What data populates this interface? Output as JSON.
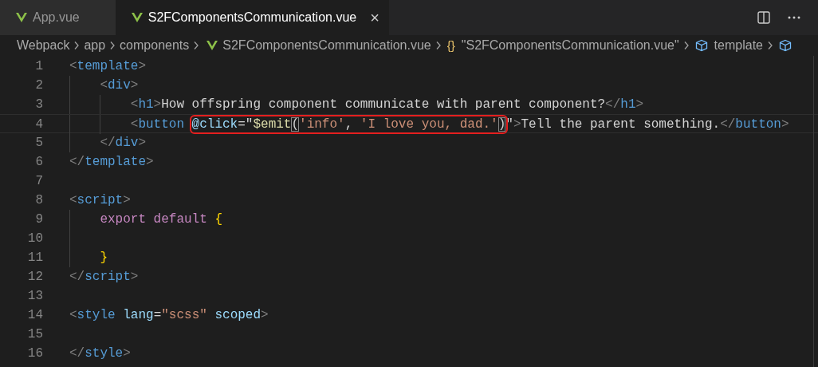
{
  "tabs": [
    {
      "label": "App.vue",
      "selected": false
    },
    {
      "label": "S2FComponentsCommunication.vue",
      "selected": true,
      "close": "×"
    }
  ],
  "breadcrumbs": [
    {
      "kind": "text",
      "label": "Webpack"
    },
    {
      "kind": "text",
      "label": "app"
    },
    {
      "kind": "text",
      "label": "components"
    },
    {
      "kind": "vue",
      "label": "S2FComponentsCommunication.vue"
    },
    {
      "kind": "object",
      "icon": "{}",
      "label": "\"S2FComponentsCommunication.vue\""
    },
    {
      "kind": "element",
      "label": "template"
    },
    {
      "kind": "element"
    }
  ],
  "lines": [
    {
      "number": "1",
      "current": false,
      "tokens": [
        {
          "kind": "punct",
          "text": "<"
        },
        {
          "kind": "tag",
          "text": "template"
        },
        {
          "kind": "punct",
          "text": ">"
        }
      ],
      "children": [
        {
          "number": "2",
          "current": false,
          "tokens": [
            {
              "kind": "punct",
              "text": "<"
            },
            {
              "kind": "tag",
              "text": "div"
            },
            {
              "kind": "punct",
              "text": ">"
            }
          ],
          "children": [
            {
              "number": "3",
              "current": false,
              "tokens": [
                {
                  "kind": "punct",
                  "text": "<"
                },
                {
                  "kind": "tag",
                  "text": "h1"
                },
                {
                  "kind": "punct",
                  "text": ">"
                },
                {
                  "kind": "text",
                  "text": "How offspring component communicate with parent component?"
                },
                {
                  "kind": "punct",
                  "text": "</"
                },
                {
                  "kind": "tag",
                  "text": "h1"
                },
                {
                  "kind": "punct",
                  "text": ">"
                }
              ]
            },
            {
              "number": "4",
              "current": true,
              "tokens": [
                {
                  "kind": "punct",
                  "text": "<"
                },
                {
                  "kind": "tag",
                  "text": "button "
                }
              ],
              "boxed": [
                {
                  "kind": "attr",
                  "text": "@click"
                },
                {
                  "kind": "text",
                  "text": "=\""
                },
                {
                  "kind": "func",
                  "text": "$emit"
                },
                {
                  "kind": "bracket",
                  "text": "("
                },
                {
                  "kind": "string",
                  "text": "'info'"
                },
                {
                  "kind": "text",
                  "text": ", "
                },
                {
                  "kind": "string",
                  "text": "'I love you, dad.'"
                },
                {
                  "kind": "bracket",
                  "text": ")"
                }
              ],
              "after": [
                {
                  "kind": "text",
                  "text": "\""
                },
                {
                  "kind": "punct",
                  "text": ">"
                },
                {
                  "kind": "text",
                  "text": "Tell the parent something."
                },
                {
                  "kind": "punct",
                  "text": "</"
                },
                {
                  "kind": "tag",
                  "text": "button"
                },
                {
                  "kind": "punct",
                  "text": ">"
                }
              ]
            }
          ]
        },
        {
          "number": "5",
          "current": false,
          "tokens": [
            {
              "kind": "punct",
              "text": "</"
            },
            {
              "kind": "tag",
              "text": "div"
            },
            {
              "kind": "punct",
              "text": ">"
            }
          ]
        }
      ]
    },
    {
      "number": "6",
      "current": false,
      "tokens": [
        {
          "kind": "punct",
          "text": "</"
        },
        {
          "kind": "tag",
          "text": "template"
        },
        {
          "kind": "punct",
          "text": ">"
        }
      ]
    },
    {
      "number": "7",
      "current": false
    },
    {
      "number": "8",
      "current": false,
      "tokens": [
        {
          "kind": "punct",
          "text": "<"
        },
        {
          "kind": "tag",
          "text": "script"
        },
        {
          "kind": "punct",
          "text": ">"
        }
      ],
      "children": [
        {
          "number": "9",
          "current": false,
          "tokens": [
            {
              "kind": "keyword",
              "text": "export default "
            },
            {
              "kind": "brace",
              "text": "{"
            }
          ]
        },
        {
          "number": "10",
          "current": false
        },
        {
          "number": "11",
          "current": false,
          "tokens": [
            {
              "kind": "brace",
              "text": "}"
            }
          ]
        }
      ]
    },
    {
      "number": "12",
      "current": false,
      "tokens": [
        {
          "kind": "punct",
          "text": "</"
        },
        {
          "kind": "tag",
          "text": "script"
        },
        {
          "kind": "punct",
          "text": ">"
        }
      ]
    },
    {
      "number": "13",
      "current": false
    },
    {
      "number": "14",
      "current": false,
      "tokens": [
        {
          "kind": "punct",
          "text": "<"
        },
        {
          "kind": "tag",
          "text": "style "
        },
        {
          "kind": "attr",
          "text": "lang"
        },
        {
          "kind": "text",
          "text": "="
        },
        {
          "kind": "string",
          "text": "\"scss\" "
        },
        {
          "kind": "attr",
          "text": "scoped"
        },
        {
          "kind": "punct",
          "text": ">"
        }
      ]
    },
    {
      "number": "15",
      "current": false
    },
    {
      "number": "16",
      "current": false,
      "tokens": [
        {
          "kind": "punct",
          "text": "</"
        },
        {
          "kind": "tag",
          "text": "style"
        },
        {
          "kind": "punct",
          "text": ">"
        }
      ]
    }
  ]
}
